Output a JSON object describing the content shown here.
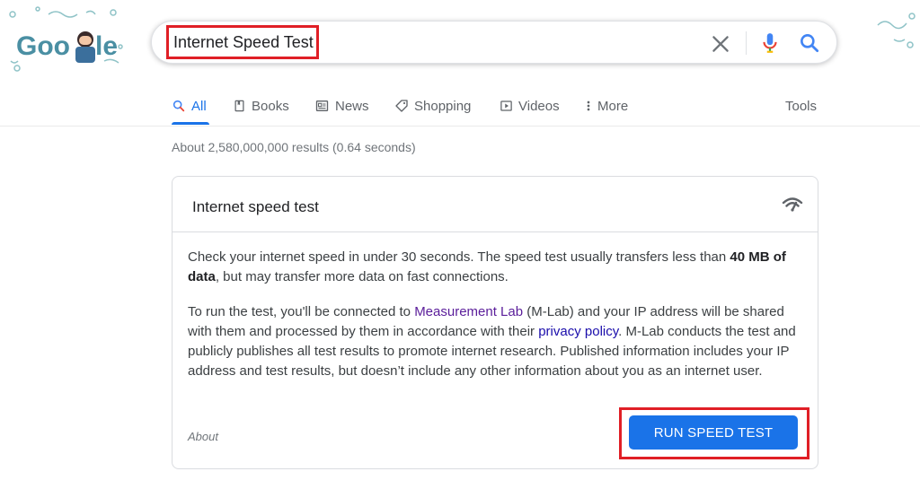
{
  "logo": {
    "text": "Google"
  },
  "search": {
    "query": "Internet Speed Test"
  },
  "icons": {
    "clear": "close-icon",
    "mic": "mic-icon",
    "search": "search-icon",
    "wifi": "wifi-speed-icon"
  },
  "colors": {
    "accent": "#1a73e8",
    "highlight_box": "#e01f26",
    "visited_link": "#5a1d9a",
    "link": "#1a0dab"
  },
  "tabs": [
    {
      "label": "All",
      "active": true
    },
    {
      "label": "Books"
    },
    {
      "label": "News"
    },
    {
      "label": "Shopping"
    },
    {
      "label": "Videos"
    },
    {
      "label": "More"
    }
  ],
  "tools_label": "Tools",
  "stats": "About 2,580,000,000 results (0.64 seconds)",
  "card": {
    "title": "Internet speed test",
    "p1_a": "Check your internet speed in under 30 seconds. The speed test usually transfers less than ",
    "p1_bold": "40 MB of data",
    "p1_b": ", but may transfer more data on fast connections.",
    "p2_a": "To run the test, you'll be connected to ",
    "p2_link1": "Measurement Lab",
    "p2_b": " (M-Lab) and your IP address will be shared with them and processed by them in accordance with their ",
    "p2_link2": "privacy policy",
    "p2_c": ". M-Lab conducts the test and publicly publishes all test results to promote internet research. Published information includes your IP address and test results, but doesn’t include any other information about you as an internet user.",
    "about": "About",
    "button": "RUN SPEED TEST"
  }
}
